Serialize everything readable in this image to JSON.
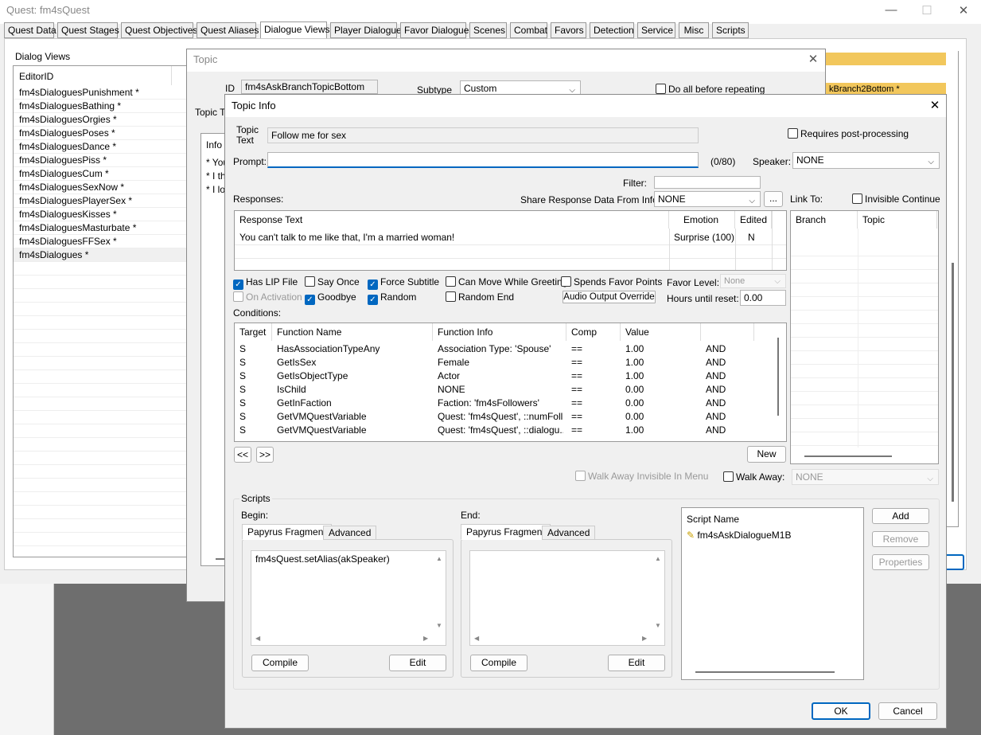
{
  "quest_window": {
    "title": "Quest: fm4sQuest",
    "tabs": [
      "Quest Data",
      "Quest Stages",
      "Quest Objectives",
      "Quest Aliases",
      "Dialogue Views",
      "Player Dialogue",
      "Favor Dialogue",
      "Scenes",
      "Combat",
      "Favors",
      "Detection",
      "Service",
      "Misc",
      "Scripts"
    ],
    "dialog_views_label": "Dialog Views",
    "editor_id_header": "EditorID",
    "dialog_views": [
      "fm4sDialoguesPunishment *",
      "fm4sDialoguesBathing *",
      "fm4sDialoguesOrgies *",
      "fm4sDialoguesPoses *",
      "fm4sDialoguesDance *",
      "fm4sDialoguesPiss *",
      "fm4sDialoguesCum *",
      "fm4sDialoguesSexNow *",
      "fm4sDialoguesPlayerSex *",
      "fm4sDialoguesKisses *",
      "fm4sDialoguesMasturbate *",
      "fm4sDialoguesFFSex *",
      "fm4sDialogues *"
    ],
    "branch_fragment": "kBranch2Bottom *"
  },
  "topic_window": {
    "title": "Topic",
    "id_label": "ID",
    "id_value": "fm4sAskBranchTopicBottom",
    "subtype_label": "Subtype",
    "subtype_value": "Custom",
    "do_all_label": "Do all before repeating",
    "topic_text_label_partial": "Topic Te",
    "info_header": "Info",
    "info_rows": [
      "* You",
      "* I th",
      "* I lo"
    ]
  },
  "topic_info": {
    "title": "Topic Info",
    "topic_text_label": "Topic\nText",
    "topic_text_value": "Follow me for sex",
    "requires_post_processing": "Requires post-processing",
    "prompt_label": "Prompt:",
    "prompt_value": "",
    "prompt_count": "(0/80)",
    "speaker_label": "Speaker:",
    "speaker_value": "NONE",
    "filter_label": "Filter:",
    "responses_label": "Responses:",
    "share_label": "Share Response Data From Info:",
    "share_value": "NONE",
    "share_button": "...",
    "link_to_label": "Link To:",
    "invisible_continue": "Invisible Continue",
    "responses_headers": [
      "Response Text",
      "Emotion",
      "Edited"
    ],
    "responses": [
      {
        "text": "You can't talk to me like that, I'm a married woman!",
        "emotion": "Surprise (100)",
        "edited": "N"
      }
    ],
    "link_headers": [
      "Branch",
      "Topic"
    ],
    "checks": {
      "has_lip": "Has LIP File",
      "say_once": "Say Once",
      "force_subtitle": "Force Subtitle",
      "can_move": "Can Move While Greeting",
      "spends_favor": "Spends Favor Points",
      "on_activation": "On Activation",
      "goodbye": "Goodbye",
      "random": "Random",
      "random_end": "Random End"
    },
    "favor_level_label": "Favor Level:",
    "favor_level_value": "None",
    "audio_override": "Audio Output Override",
    "hours_label": "Hours until reset:",
    "hours_value": "0.00",
    "conditions_label": "Conditions:",
    "conditions_headers": [
      "Target",
      "Function Name",
      "Function Info",
      "Comp",
      "Value"
    ],
    "conditions": [
      {
        "target": "S",
        "fn": "HasAssociationTypeAny",
        "info": "Association Type: 'Spouse'",
        "comp": "==",
        "value": "1.00",
        "op": "AND"
      },
      {
        "target": "S",
        "fn": "GetIsSex",
        "info": "Female",
        "comp": "==",
        "value": "1.00",
        "op": "AND"
      },
      {
        "target": "S",
        "fn": "GetIsObjectType",
        "info": "Actor",
        "comp": "==",
        "value": "1.00",
        "op": "AND"
      },
      {
        "target": "S",
        "fn": "IsChild",
        "info": "NONE",
        "comp": "==",
        "value": "0.00",
        "op": "AND"
      },
      {
        "target": "S",
        "fn": "GetInFaction",
        "info": "Faction: 'fm4sFollowers'",
        "comp": "==",
        "value": "0.00",
        "op": "AND"
      },
      {
        "target": "S",
        "fn": "GetVMQuestVariable",
        "info": "Quest: 'fm4sQuest', ::numFoll...",
        "comp": "==",
        "value": "0.00",
        "op": "AND"
      },
      {
        "target": "S",
        "fn": "GetVMQuestVariable",
        "info": "Quest: 'fm4sQuest', ::dialogu...",
        "comp": "==",
        "value": "1.00",
        "op": "AND"
      }
    ],
    "prev_btn": "<<",
    "next_btn": ">>",
    "new_btn": "New",
    "walk_away_invisible": "Walk Away Invisible In Menu",
    "walk_away": "Walk Away:",
    "walk_away_value": "NONE",
    "scripts_label": "Scripts",
    "begin_label": "Begin:",
    "end_label": "End:",
    "papyrus_tab": "Papyrus Fragment",
    "advanced_tab": "Advanced",
    "begin_code": "fm4sQuest.setAlias(akSpeaker)",
    "end_code": "",
    "compile_btn": "Compile",
    "edit_btn": "Edit",
    "script_name_header": "Script Name",
    "script_name": "fm4sAskDialogueM1B",
    "add_btn": "Add",
    "remove_btn": "Remove",
    "properties_btn": "Properties",
    "ok_btn": "OK",
    "cancel_btn": "Cancel"
  },
  "colors": {
    "accent": "#0067c0",
    "highlight": "#f2c75c"
  }
}
